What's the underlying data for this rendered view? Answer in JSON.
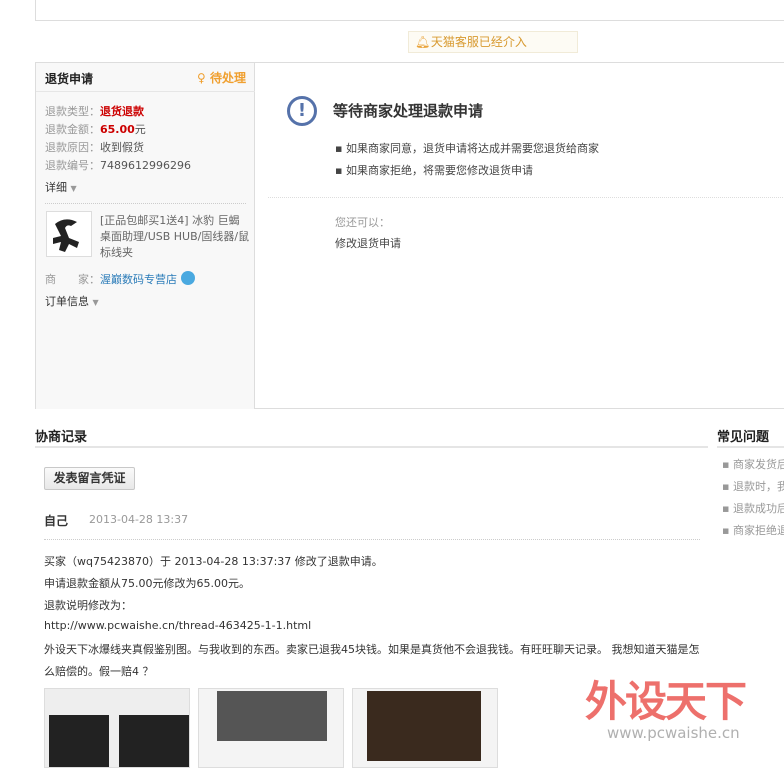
{
  "notice": {
    "icon": "bell-icon",
    "text": "天猫客服已经介入"
  },
  "refund": {
    "header": "退货申请",
    "status": "待处理",
    "status_icon": "lightbulb-icon",
    "fields": [
      {
        "label": "退款类型：",
        "value": "退货退款"
      },
      {
        "label": "退款金额：",
        "value": "65.00",
        "unit": "元"
      },
      {
        "label": "退款原因：",
        "value": "收到假货"
      },
      {
        "label": "退款编号：",
        "value": "7489612996296"
      }
    ],
    "detail_toggle": "详细",
    "product_title": "[正品包邮买1送4] 冰豹 巨蝎 桌面助理/USB HUB/固线器/鼠标线夹",
    "seller_label": "商　　家：",
    "seller_name": "渥巅数码专营店",
    "order_toggle": "订单信息"
  },
  "main": {
    "title": "等待商家处理退款申请",
    "bullets": [
      "如果商家同意，退货申请将达成并需要您退货给商家",
      "如果商家拒绝，将需要您修改退货申请"
    ],
    "can_label": "您还可以：",
    "action_link": "修改退货申请"
  },
  "negotiation": {
    "title": "协商记录",
    "post_button": "发表留言凭证",
    "author": "自己",
    "time": "2013-04-28 13:37",
    "lines": [
      "买家（wq75423870）于 2013-04-28 13:37:37 修改了退款申请。",
      "申请退款金额从75.00元修改为65.00元。",
      "退款说明修改为：",
      "http://www.pcwaishe.cn/thread-463425-1-1.html",
      "外设天下冰爆线夹真假鉴别图。与我收到的东西。卖家已退我45块钱。如果是真货他不会退我钱。有旺旺聊天记录。 我想知道天猫是怎",
      "么赔偿的。假一赔4 ？"
    ]
  },
  "faq": {
    "title": "常见问题",
    "items": [
      "商家发货后",
      "退款时，我",
      "退款成功后",
      "商家拒绝退"
    ]
  },
  "watermark": {
    "text": "外设天下",
    "url": "www.pcwaishe.cn"
  }
}
